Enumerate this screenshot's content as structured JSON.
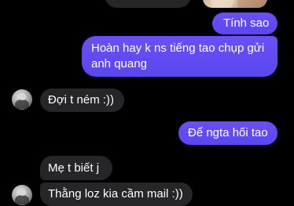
{
  "conversation": {
    "messages": [
      {
        "direction": "sent",
        "text": "Tính sao"
      },
      {
        "direction": "sent",
        "text": "Hoàn hay k ns tiếng tao chụp gửi anh quang"
      },
      {
        "direction": "received",
        "text": "Đợi t ném :))"
      },
      {
        "direction": "sent",
        "text": "Để ngta hối tao"
      },
      {
        "direction": "received",
        "text": "Mẹ t biết j"
      },
      {
        "direction": "received",
        "text": "Thằng loz kia cầm mail :))"
      }
    ]
  },
  "colors": {
    "background": "#000000",
    "sent_bubble": "#5a46f0",
    "received_bubble": "#262629",
    "text": "#ffffff"
  }
}
